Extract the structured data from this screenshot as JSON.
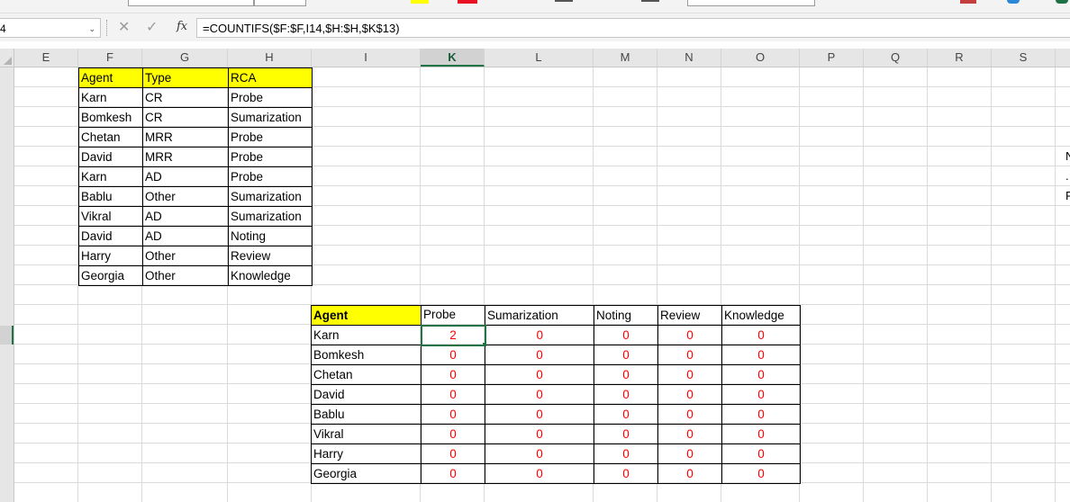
{
  "ribbon": {
    "accent_yellow": "#ffff00",
    "accent_red": "#e81123"
  },
  "formula_bar": {
    "name_box": "4",
    "cancel_glyph": "✕",
    "enter_glyph": "✓",
    "fx_label": "fx",
    "formula": "=COUNTIFS($F:$F,I14,$H:$H,$K$13)"
  },
  "columns": [
    "E",
    "F",
    "G",
    "H",
    "I",
    "K",
    "L",
    "M",
    "N",
    "O",
    "P",
    "Q",
    "R",
    "S"
  ],
  "active_column": "K",
  "source_table": {
    "headers": [
      "Agent",
      "Type",
      "RCA"
    ],
    "rows": [
      [
        "Karn",
        "CR",
        "Probe"
      ],
      [
        "Bomkesh",
        "CR",
        "Sumarization"
      ],
      [
        "Chetan",
        "MRR",
        "Probe"
      ],
      [
        "David",
        "MRR",
        "Probe"
      ],
      [
        "Karn",
        "AD",
        "Probe"
      ],
      [
        "Bablu",
        "Other",
        "Sumarization"
      ],
      [
        "Vikral",
        "AD",
        "Sumarization"
      ],
      [
        "David",
        "AD",
        "Noting"
      ],
      [
        "Harry",
        "Other",
        "Review"
      ],
      [
        "Georgia",
        "Other",
        "Knowledge"
      ]
    ],
    "header_color": "#ffff00"
  },
  "summary_table": {
    "headers": [
      "Agent",
      "Probe",
      "Sumarization",
      "Noting",
      "Review",
      "Knowledge"
    ],
    "rows": [
      [
        "Karn",
        "2",
        "0",
        "0",
        "0",
        "0"
      ],
      [
        "Bomkesh",
        "0",
        "0",
        "0",
        "0",
        "0"
      ],
      [
        "Chetan",
        "0",
        "0",
        "0",
        "0",
        "0"
      ],
      [
        "David",
        "0",
        "0",
        "0",
        "0",
        "0"
      ],
      [
        "Bablu",
        "0",
        "0",
        "0",
        "0",
        "0"
      ],
      [
        "Vikral",
        "0",
        "0",
        "0",
        "0",
        "0"
      ],
      [
        "Harry",
        "0",
        "0",
        "0",
        "0",
        "0"
      ],
      [
        "Georgia",
        "0",
        "0",
        "0",
        "0",
        "0"
      ]
    ],
    "value_color": "#ff0000",
    "selection_color": "#217346"
  },
  "edge_fragments": [
    "N",
    ".",
    "F"
  ]
}
